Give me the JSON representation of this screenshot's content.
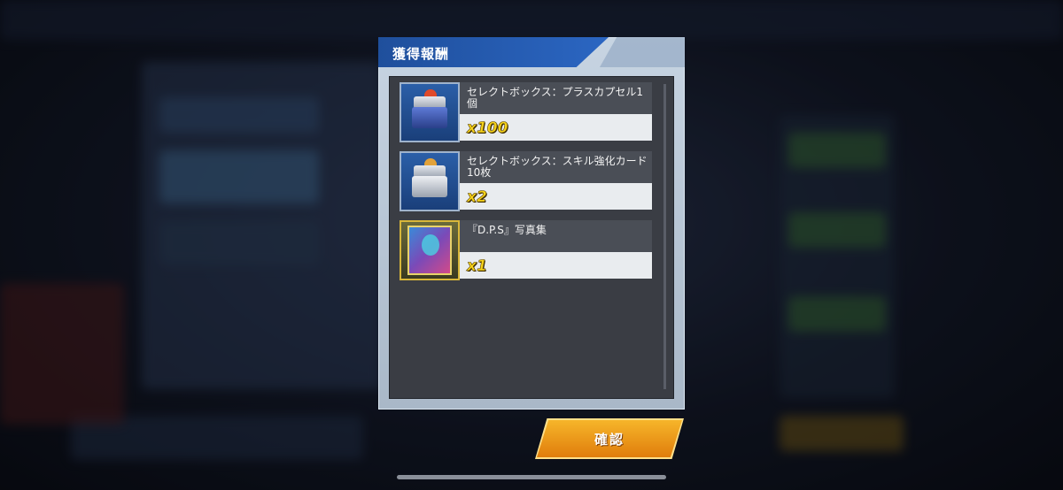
{
  "dialog": {
    "title": "獲得報酬"
  },
  "rewards": [
    {
      "name": "セレクトボックス：プラスカプセル1個",
      "quantity": "x100",
      "icon": "capsule-selectbox-icon"
    },
    {
      "name": "セレクトボックス：スキル強化カード10枚",
      "quantity": "x2",
      "icon": "skill-card-selectbox-icon"
    },
    {
      "name": "『D.P.S』写真集",
      "quantity": "x1",
      "icon": "photo-album-icon"
    }
  ],
  "confirm_button": {
    "label": "確認"
  },
  "colors": {
    "title_bar": "#2b66c2",
    "quantity_text": "#f5d21a",
    "confirm_button": "#f09a1a"
  }
}
